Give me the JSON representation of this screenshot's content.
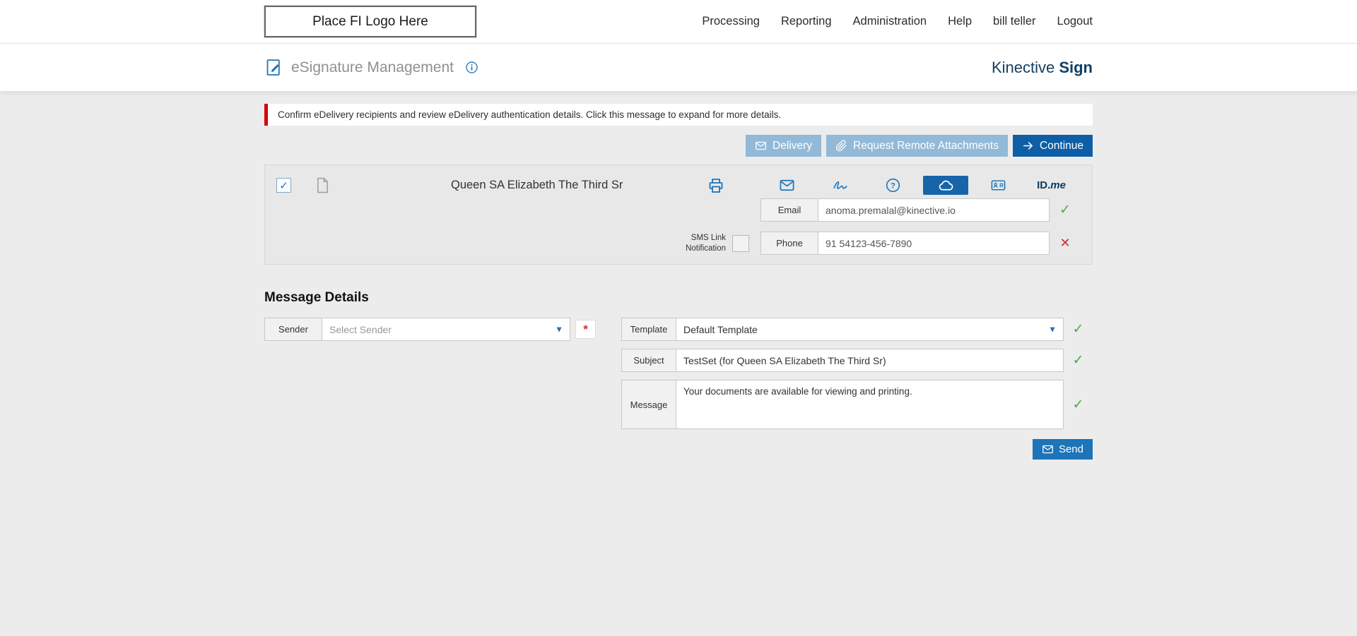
{
  "topbar": {
    "logo_text": "Place FI Logo Here",
    "nav": [
      {
        "label": "Processing"
      },
      {
        "label": "Reporting"
      },
      {
        "label": "Administration"
      },
      {
        "label": "Help"
      },
      {
        "label": "bill teller"
      },
      {
        "label": "Logout"
      }
    ]
  },
  "header": {
    "title": "eSignature Management",
    "brand": {
      "name": "Kinective ",
      "product": "Sign"
    }
  },
  "alert": {
    "text": "Confirm eDelivery recipients and review eDelivery authentication details. Click this message to expand for more details."
  },
  "toolbar": {
    "delivery_label": "Delivery",
    "request_remote_label": "Request Remote Attachments",
    "continue_label": "Continue"
  },
  "recipient": {
    "name": "Queen SA Elizabeth The Third Sr",
    "email": {
      "label": "Email",
      "value": "anoma.premalal@kinective.io",
      "status": "valid"
    },
    "sms": {
      "label": "SMS Link Notification",
      "checked": false
    },
    "phone": {
      "label": "Phone",
      "value": "91 54123-456-7890",
      "status": "invalid"
    },
    "auth_methods": [
      "email-delivery",
      "signature",
      "security-question",
      "cloud",
      "remote-id",
      "idme"
    ],
    "selected_auth_method": "cloud",
    "idme": {
      "bold": "ID.",
      "me": "me"
    }
  },
  "message_details": {
    "heading": "Message Details",
    "sender": {
      "label": "Sender",
      "placeholder": "Select Sender",
      "required": true
    },
    "template": {
      "label": "Template",
      "value": "Default Template",
      "status": "valid"
    },
    "subject": {
      "label": "Subject",
      "value": "TestSet (for Queen SA Elizabeth The Third Sr)",
      "status": "valid"
    },
    "message": {
      "label": "Message",
      "value": "Your documents are available for viewing and printing.",
      "status": "valid"
    },
    "send_label": "Send"
  },
  "icons": {
    "check": "✓",
    "cross": "✕",
    "caret": "▼",
    "required": "*",
    "checkbox_check": "✓"
  },
  "colors": {
    "primary_blue": "#1c75bc",
    "dark_blue": "#0d5ea6",
    "muted_button_blue": "#92b9d8",
    "brand_navy": "#123f63",
    "success_green": "#3faf46",
    "error_red": "#d22c2c",
    "alert_red": "#d60000",
    "page_background": "#ececec"
  }
}
